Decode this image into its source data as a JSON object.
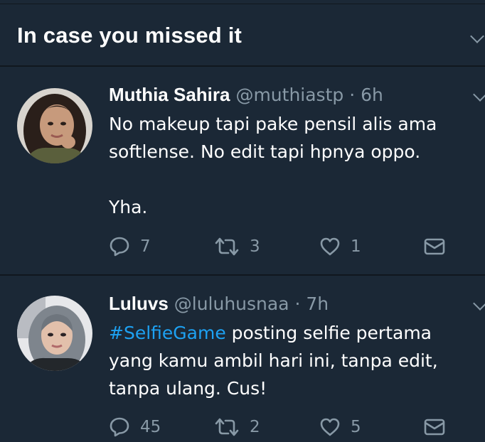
{
  "section": {
    "title": "In case you missed it"
  },
  "tweets": [
    {
      "name": "Muthia Sahira",
      "handle": "@muthiastp",
      "sep": "·",
      "time": "6h",
      "text": "No makeup tapi pake pensil alis ama\nsoftlense. No edit tapi hpnya oppo.\n\nYha.",
      "replies": "7",
      "retweets": "3",
      "likes": "1"
    },
    {
      "name": "Luluvs",
      "handle": "@luluhusnaa",
      "sep": "·",
      "time": "7h",
      "hashtag": "#SelfieGame",
      "text": " posting selfie pertama\nyang kamu ambil hari ini, tanpa edit,\ntanpa ulang. Cus!",
      "replies": "45",
      "retweets": "2",
      "likes": "5"
    }
  ],
  "colors": {
    "background": "#1b2836",
    "divider": "#10171e",
    "secondary": "#8899a6",
    "link": "#1da1f2"
  },
  "icons": [
    "reply-icon",
    "retweet-icon",
    "like-icon",
    "dm-icon",
    "chevron-down-icon"
  ]
}
